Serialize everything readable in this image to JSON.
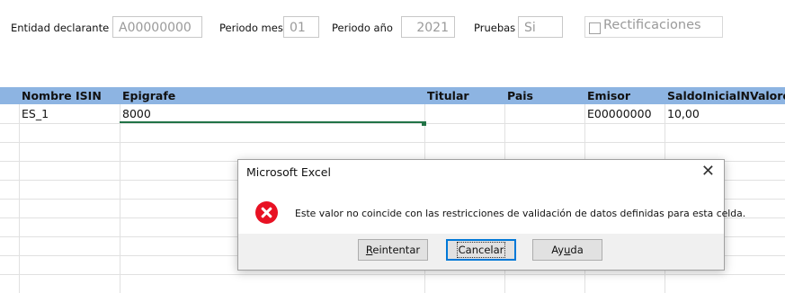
{
  "form": {
    "entidad_label": "Entidad declarante",
    "entidad_value": "A00000000",
    "periodo_mes_label": "Periodo mes",
    "periodo_mes_value": "01",
    "periodo_anio_label": "Periodo año",
    "periodo_anio_value": "2021",
    "pruebas_label": "Pruebas",
    "pruebas_value": "Si",
    "rectificaciones_label": "Rectificaciones"
  },
  "grid": {
    "headers": [
      "Nombre ISIN",
      "Epigrafe",
      "Titular",
      "Pais",
      "Emisor",
      "SaldoInicialNValores"
    ],
    "rows": [
      [
        "ES_1",
        "8000",
        "",
        "",
        "E00000000",
        "10,00"
      ]
    ]
  },
  "dialog": {
    "title": "Microsoft Excel",
    "close_glyph": "✕",
    "message": "Este valor no coincide con las restricciones de validación de datos definidas para esta celda.",
    "buttons": {
      "retry": {
        "pre": "",
        "u": "R",
        "post": "eintentar"
      },
      "cancel": "Cancelar",
      "help": {
        "pre": "Ay",
        "u": "u",
        "post": "da"
      }
    },
    "icon": "error-icon"
  },
  "colors": {
    "header_bg": "#8db4e2",
    "selection": "#217346",
    "error": "#e81123",
    "default_button_border": "#0078d7"
  }
}
